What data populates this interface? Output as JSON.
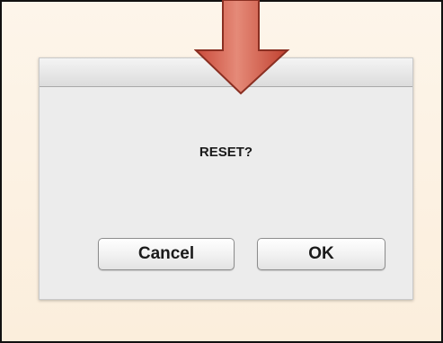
{
  "dialog": {
    "message": "RESET?",
    "cancel_label": "Cancel",
    "ok_label": "OK"
  },
  "colors": {
    "arrow_fill": "#d9624f",
    "arrow_stroke": "#8a2f22",
    "backdrop": "#fbeedc",
    "dialog_bg": "#ececec"
  },
  "icons": {
    "annotation": "down-arrow-icon"
  }
}
